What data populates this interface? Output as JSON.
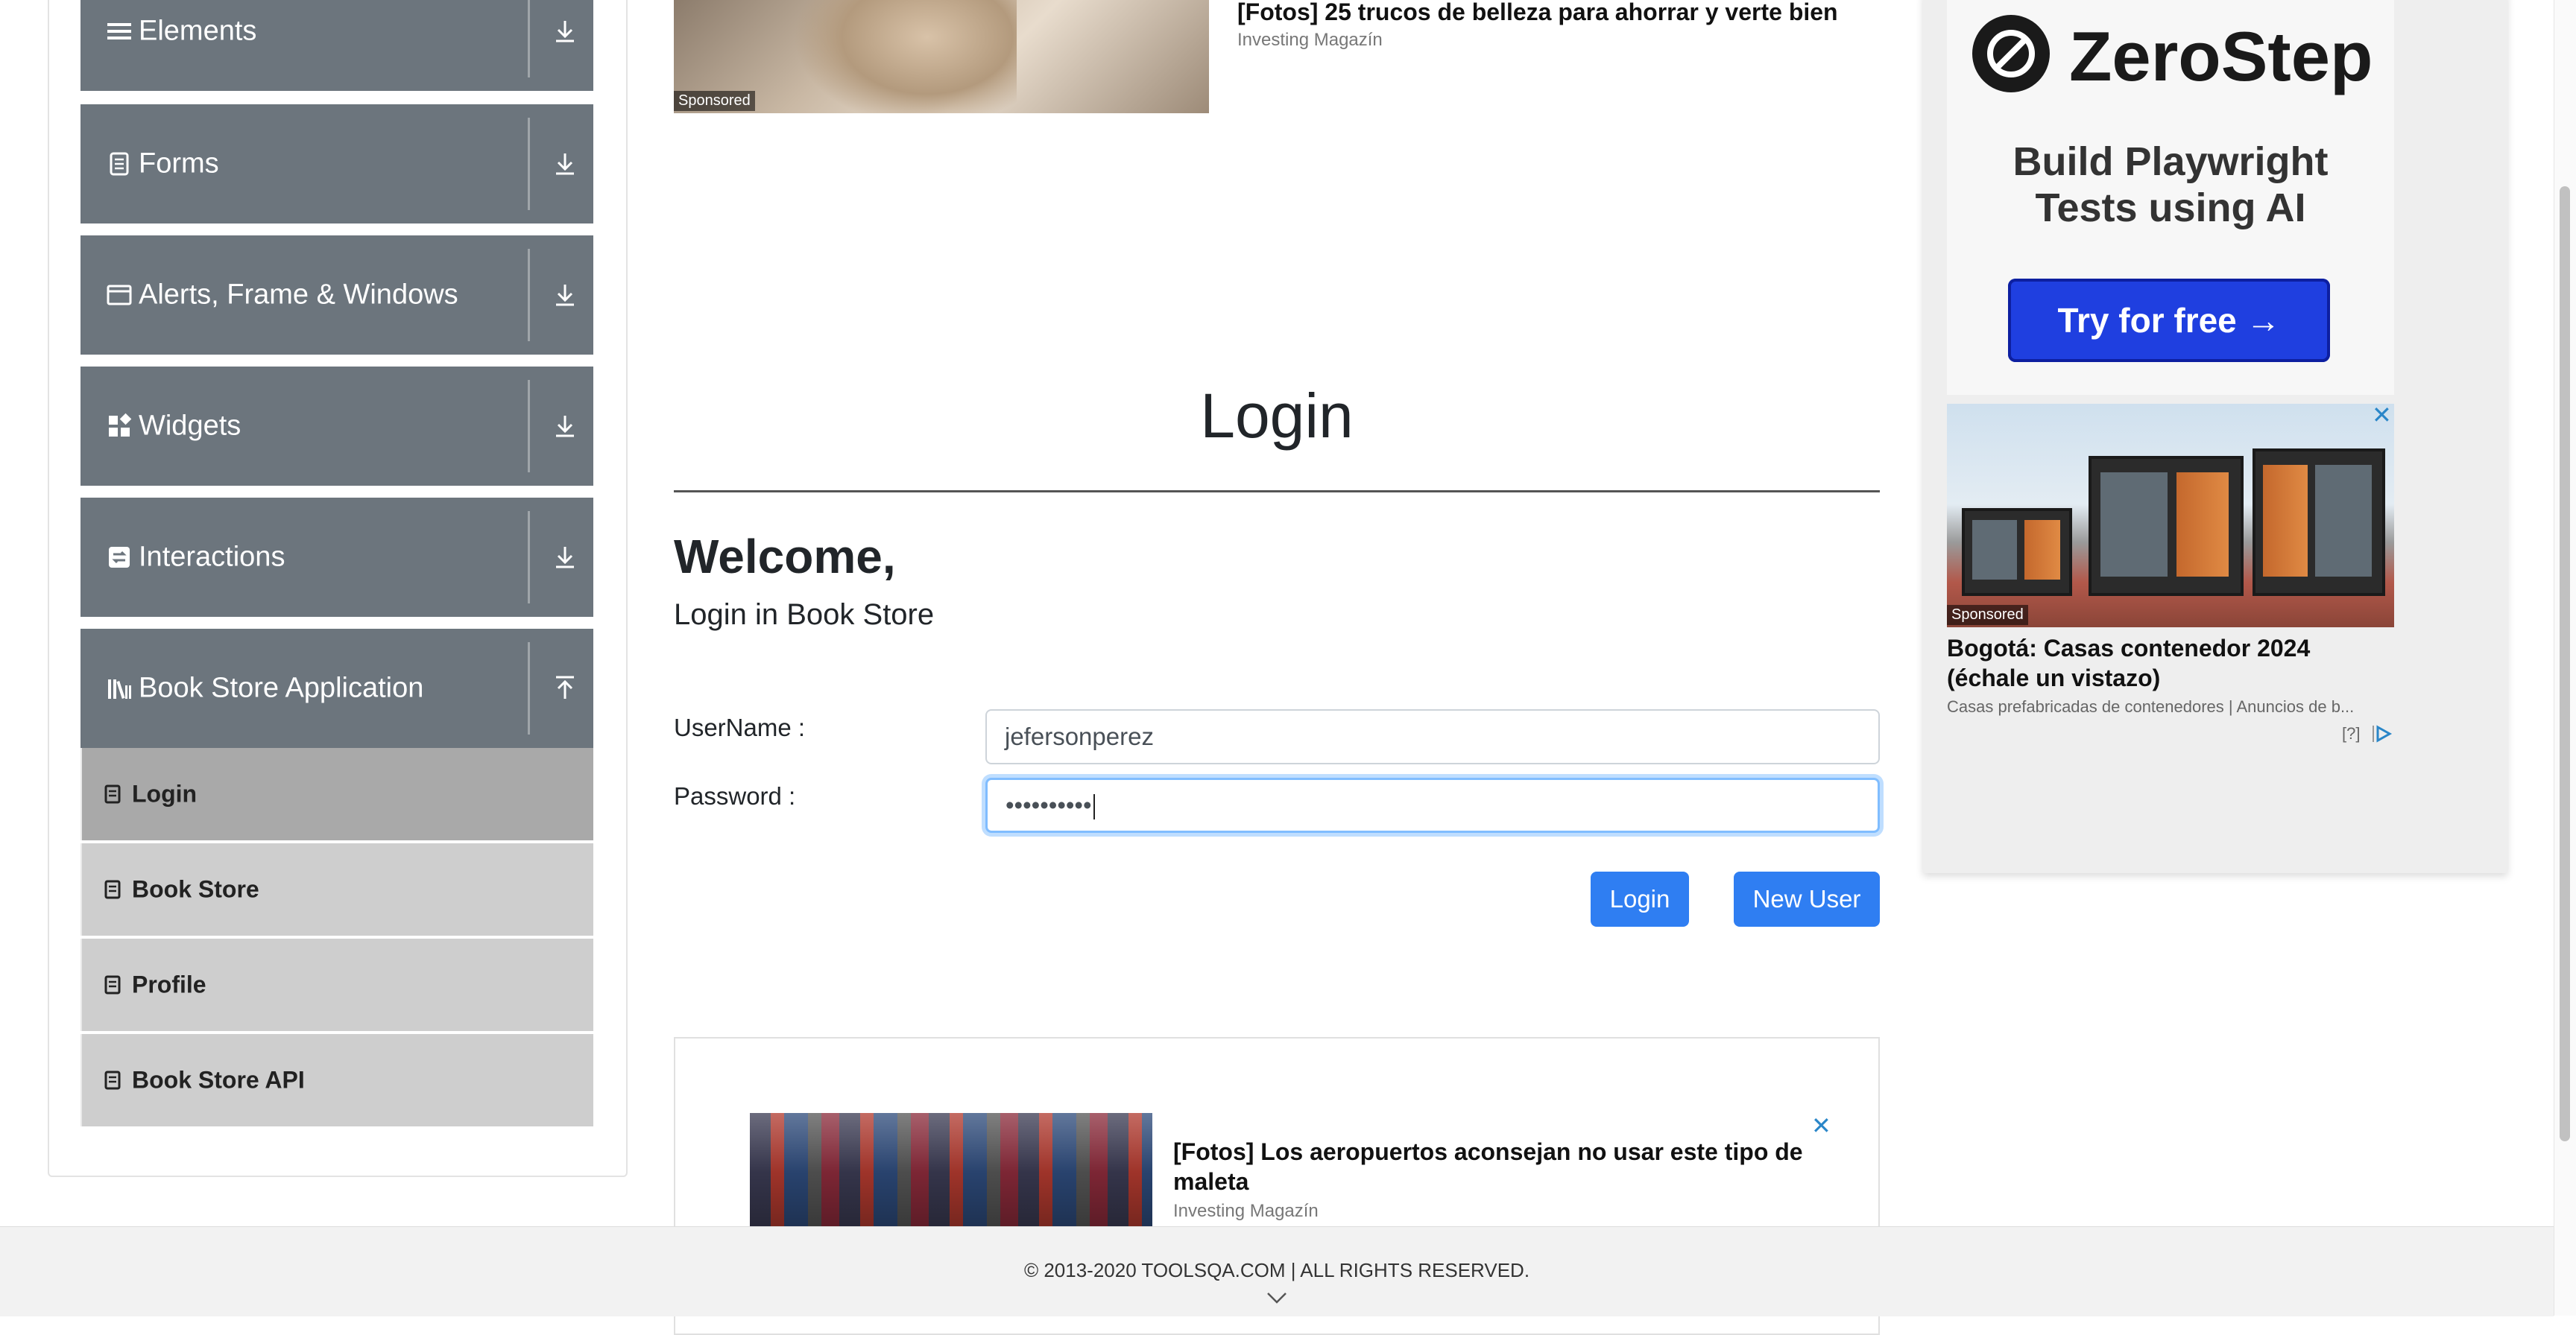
{
  "sidebar": {
    "groups": [
      {
        "label": "Elements",
        "icon": "hamburger-icon",
        "toggle": "download-arrow-icon"
      },
      {
        "label": "Forms",
        "icon": "document-icon",
        "toggle": "download-arrow-icon"
      },
      {
        "label": "Alerts, Frame & Windows",
        "icon": "window-icon",
        "toggle": "download-arrow-icon"
      },
      {
        "label": "Widgets",
        "icon": "widgets-icon",
        "toggle": "download-arrow-icon"
      },
      {
        "label": "Interactions",
        "icon": "interactions-icon",
        "toggle": "download-arrow-icon"
      },
      {
        "label": "Book Store Application",
        "icon": "library-icon",
        "toggle": "upload-arrow-icon"
      }
    ],
    "items": [
      {
        "label": "Login",
        "active": true
      },
      {
        "label": "Book Store"
      },
      {
        "label": "Profile"
      },
      {
        "label": "Book Store API"
      }
    ]
  },
  "top_ad": {
    "headline": "[Fotos] 25 trucos de belleza para ahorrar y verte bien",
    "source": "Investing Magazín",
    "sponsored": "Sponsored"
  },
  "page": {
    "title": "Login",
    "welcome": "Welcome,",
    "subtitle": "Login in Book Store"
  },
  "form": {
    "username_label": "UserName :",
    "username_value": "jefersonperez",
    "password_label": "Password :",
    "password_value": "••••••••••"
  },
  "buttons": {
    "login": "Login",
    "new_user": "New User"
  },
  "bottom_ad": {
    "headline": "[Fotos] Los aeropuertos aconsejan no usar este tipo de maleta",
    "source": "Investing Magazín",
    "close": "✕"
  },
  "right_ad": {
    "brand": "ZeroStep",
    "tagline_line1": "Build Playwright",
    "tagline_line2": "Tests using AI",
    "cta": "Try for free →",
    "sponsored": "Sponsored",
    "headline": "Bogotá: Casas contenedor 2024 (échale un vistazo)",
    "source": "Casas prefabricadas de contenedores | Anuncios de b...",
    "info": "[?]",
    "close": "✕"
  },
  "footer": {
    "text": "© 2013-2020 TOOLSQA.COM | ALL RIGHTS RESERVED."
  },
  "colors": {
    "sidebar_group": "#6c757d",
    "menu_item": "#cecece",
    "menu_item_active": "#a9a9a9",
    "primary_button": "#2f7ef2",
    "cta_blue": "#1f3fe0"
  }
}
